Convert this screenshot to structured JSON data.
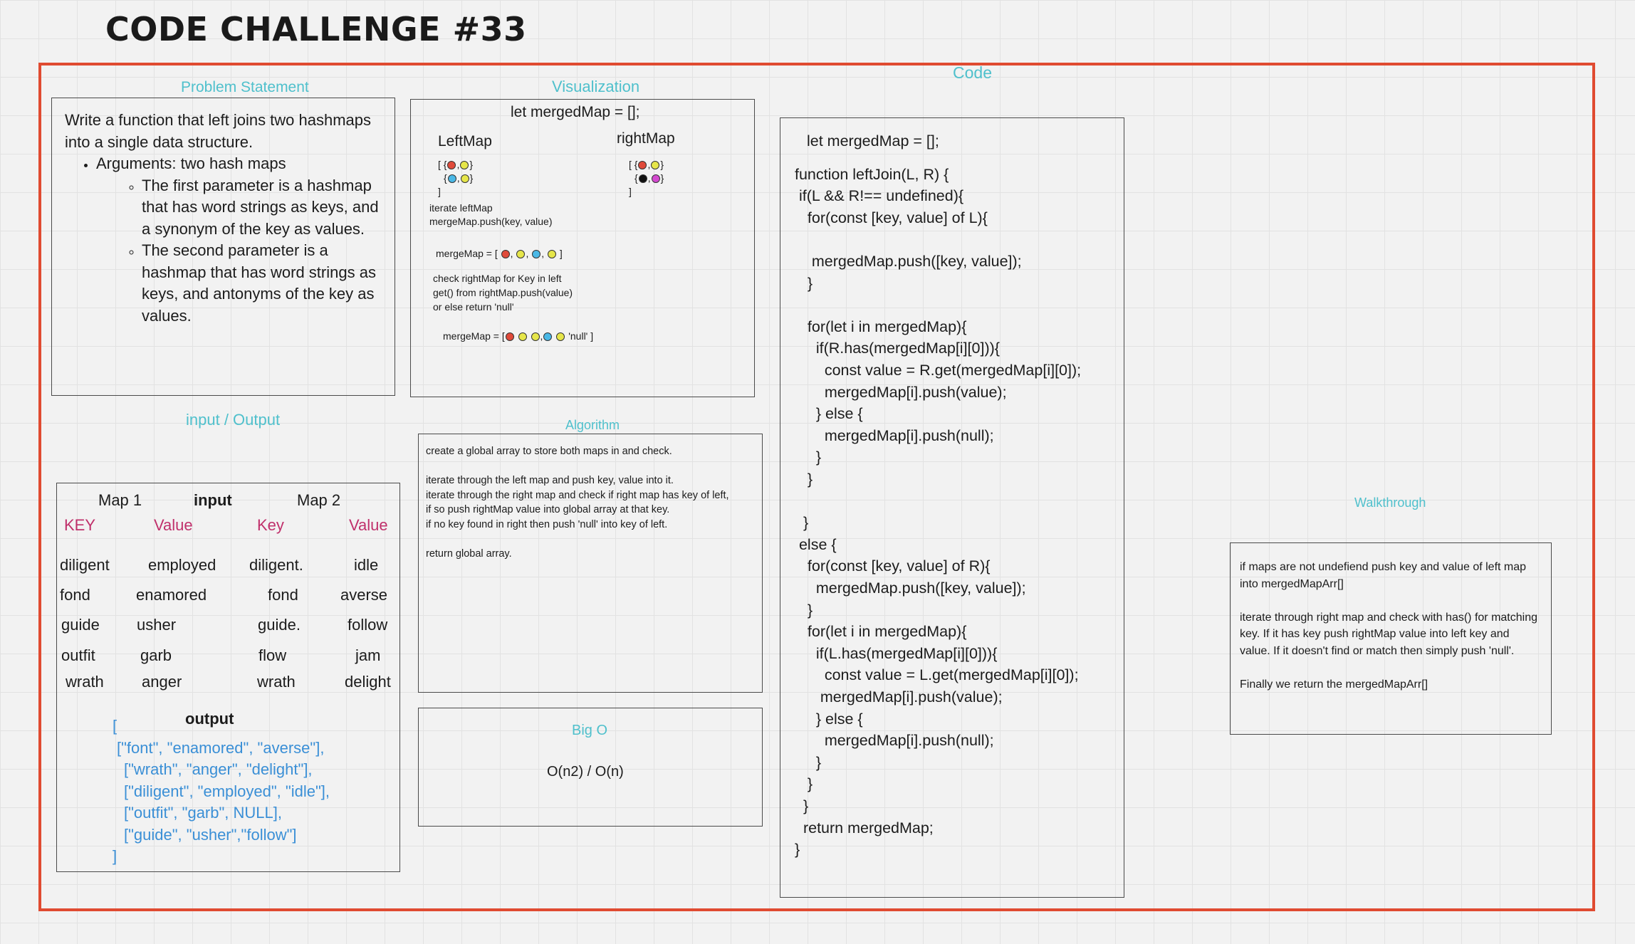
{
  "title": "CODE CHALLENGE #33",
  "sections": {
    "problem": "Problem Statement",
    "visualization": "Visualization",
    "code": "Code",
    "io": "input / Output",
    "algorithm": "Algorithm",
    "bigo": "Big O",
    "walkthrough": "Walkthrough"
  },
  "problem": {
    "intro": "Write a function that left joins two hashmaps into a single data structure.",
    "args": "Arguments: two hash maps",
    "param1": "The first parameter is a hashmap that has word strings as keys, and a synonym of the key as values.",
    "param2": "The second parameter is a hashmap that has word strings as keys, and antonyms of the key as values."
  },
  "viz": {
    "top": "let mergedMap = [];",
    "left_map": "LeftMap",
    "right_map": "rightMap",
    "bracket_open": "[",
    "bracket_close": "]",
    "brace_open": "{",
    "brace_close": "}",
    "comma": ",",
    "iterate": "iterate leftMap",
    "push": "mergeMap.push(key, value)",
    "merge1": "mergeMap = [",
    "check1": "check rightMap for Key in left",
    "check2": "get() from rightMap.push(value)",
    "check3": "or else return 'null'",
    "merge2": "mergeMap = [",
    "null_val": "'null'",
    "colors": {
      "red": "#e04a3a",
      "yellow": "#e6e64a",
      "blue": "#4ab8e6",
      "black": "#111111",
      "magenta": "#d44ad0"
    }
  },
  "io": {
    "map1": "Map 1",
    "input": "input",
    "map2": "Map 2",
    "headers": [
      "KEY",
      "Value",
      "Key",
      "Value"
    ],
    "rows": [
      [
        "diligent",
        "employed",
        "diligent.",
        "idle"
      ],
      [
        "fond",
        "enamored",
        "fond",
        "averse"
      ],
      [
        "guide",
        "usher",
        "guide.",
        "follow"
      ],
      [
        "outfit",
        "garb",
        "flow",
        "jam"
      ],
      [
        "wrath",
        "anger",
        "wrath",
        "delight"
      ]
    ],
    "output_label": "output",
    "output_lines": [
      "[",
      "[\"font\", \"enamored\", \"averse\"],",
      "[\"wrath\", \"anger\", \"delight\"],",
      "[\"diligent\", \"employed\", \"idle\"],",
      "[\"outfit\", \"garb\", NULL],",
      "[\"guide\", \"usher\",\"follow\"]",
      "]"
    ]
  },
  "algorithm": [
    "create a global array to store both maps in and check.",
    "",
    "iterate through the left map and push key, value into it.",
    "iterate through the right map and check if right map has key of left,",
    "if so push rightMap value into global array at that key.",
    "if no key found in right then push 'null' into key of left.",
    "",
    "return global array."
  ],
  "bigo_value": "O(n2) / O(n)",
  "code_lines": [
    "let mergedMap = [];",
    "function leftJoin(L, R) {",
    " if(L && R!== undefined){",
    "   for(const [key, value] of L){",
    "",
    "    mergedMap.push([key, value]);",
    "   }",
    "",
    "   for(let i in mergedMap){",
    "     if(R.has(mergedMap[i][0])){",
    "       const value = R.get(mergedMap[i][0]);",
    "       mergedMap[i].push(value);",
    "     } else {",
    "       mergedMap[i].push(null);",
    "     }",
    "   }",
    "",
    "  }",
    " else {",
    "   for(const [key, value] of R){",
    "     mergedMap.push([key, value]);",
    "   }",
    "   for(let i in mergedMap){",
    "     if(L.has(mergedMap[i][0])){",
    "       const value = L.get(mergedMap[i][0]);",
    "      mergedMap[i].push(value);",
    "     } else {",
    "       mergedMap[i].push(null);",
    "     }",
    "   }",
    "  }",
    "  return mergedMap;",
    "}"
  ],
  "walkthrough": [
    "if maps are not undefiend push key and value of left map into mergedMapArr[]",
    "",
    "iterate through right map and check with has() for matching key. If it has key push rightMap value into left key and value. If it doesn't find or match then simply push 'null'.",
    "",
    "Finally we return the mergedMapArr[]"
  ]
}
